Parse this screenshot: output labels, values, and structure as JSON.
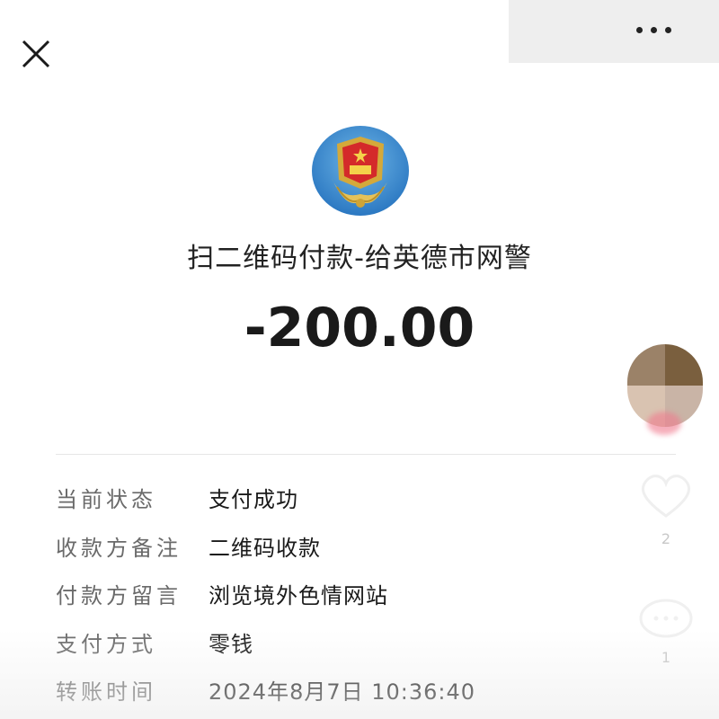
{
  "header": {
    "close_icon": "close-icon",
    "more_icon": "more-horizontal-icon"
  },
  "payment": {
    "merchant_icon": "police-emblem-icon",
    "title": "扫二维码付款-给英德市网警",
    "amount": "-200.00"
  },
  "details": [
    {
      "label": "当前状态",
      "value": "支付成功"
    },
    {
      "label": "收款方备注",
      "value": "二维码收款"
    },
    {
      "label": "付款方留言",
      "value": "浏览境外色情网站"
    },
    {
      "label": "支付方式",
      "value": "零钱"
    },
    {
      "label": "转账时间",
      "value": "2024年8月7日  10:36:40"
    }
  ],
  "side_panel": {
    "like_icon": "heart-icon",
    "like_count": "2",
    "comment_icon": "comment-icon",
    "comment_count": "1"
  },
  "colors": {
    "background": "#ffffff",
    "label_text": "#6a6a6a",
    "value_text": "#1a1a1a"
  }
}
